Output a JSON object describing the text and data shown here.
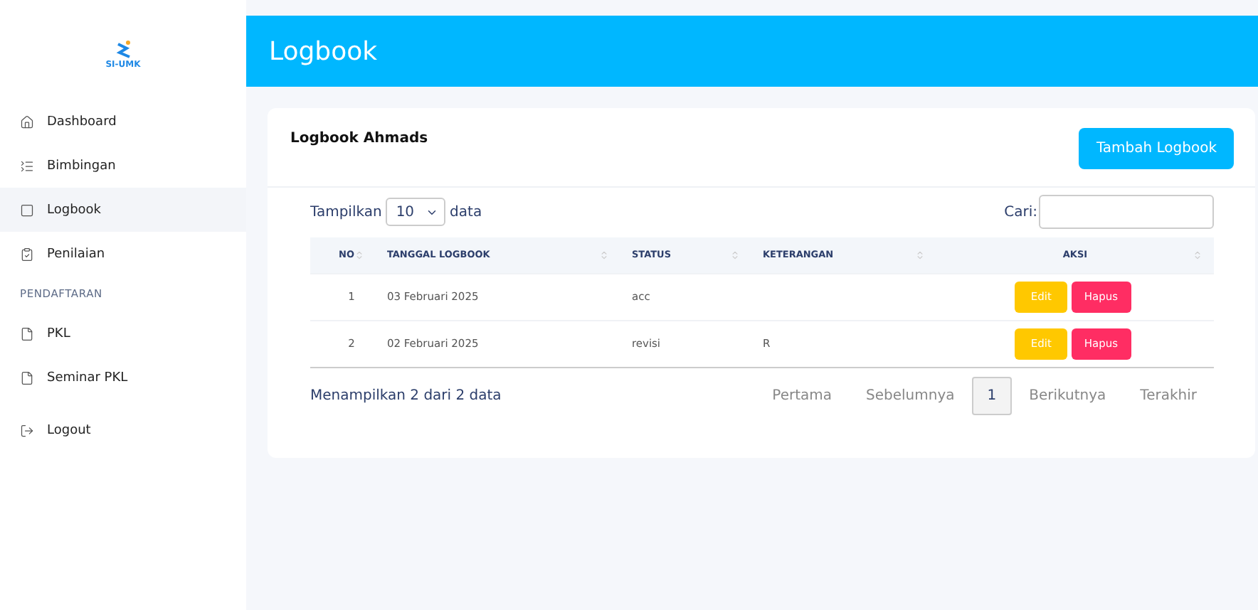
{
  "logo": {
    "text": "SI-UMK"
  },
  "sidebar": {
    "items": [
      {
        "kind": "link",
        "label": "Dashboard",
        "selected": false
      },
      {
        "kind": "link",
        "label": "Bimbingan",
        "selected": false
      },
      {
        "kind": "link",
        "label": "Logbook",
        "selected": true
      },
      {
        "kind": "link",
        "label": "Penilaian",
        "selected": false
      },
      {
        "kind": "section",
        "label": "PENDAFTARAN"
      },
      {
        "kind": "link",
        "label": "PKL",
        "selected": false
      },
      {
        "kind": "link",
        "label": "Seminar PKL",
        "selected": false
      },
      {
        "kind": "link",
        "label": "Logout",
        "selected": false
      }
    ]
  },
  "header": {
    "title": "Logbook"
  },
  "card": {
    "title": "Logbook Ahmads",
    "add_button": "Tambah Logbook",
    "length": {
      "before": "Tampilkan",
      "value": "10",
      "after": "data"
    },
    "search": {
      "label": "Cari:"
    },
    "table": {
      "columns": [
        "NO",
        "TANGGAL LOGBOOK",
        "STATUS",
        "KETERANGAN",
        "AKSI"
      ],
      "rows": [
        {
          "no": "1",
          "date": "03 Februari 2025",
          "status": "acc",
          "note": "",
          "actions": [
            "Edit",
            "Hapus"
          ]
        },
        {
          "no": "2",
          "date": "02 Februari 2025",
          "status": "revisi",
          "note": "R",
          "actions": [
            "Edit",
            "Hapus"
          ]
        }
      ]
    },
    "info": "Menampilkan 2 dari 2 data",
    "pagination": [
      {
        "label": "Pertama",
        "selected": false
      },
      {
        "label": "Sebelumnya",
        "selected": false
      },
      {
        "label": "1",
        "selected": true
      },
      {
        "label": "Berikutnya",
        "selected": false
      },
      {
        "label": "Terakhir",
        "selected": false
      }
    ]
  }
}
